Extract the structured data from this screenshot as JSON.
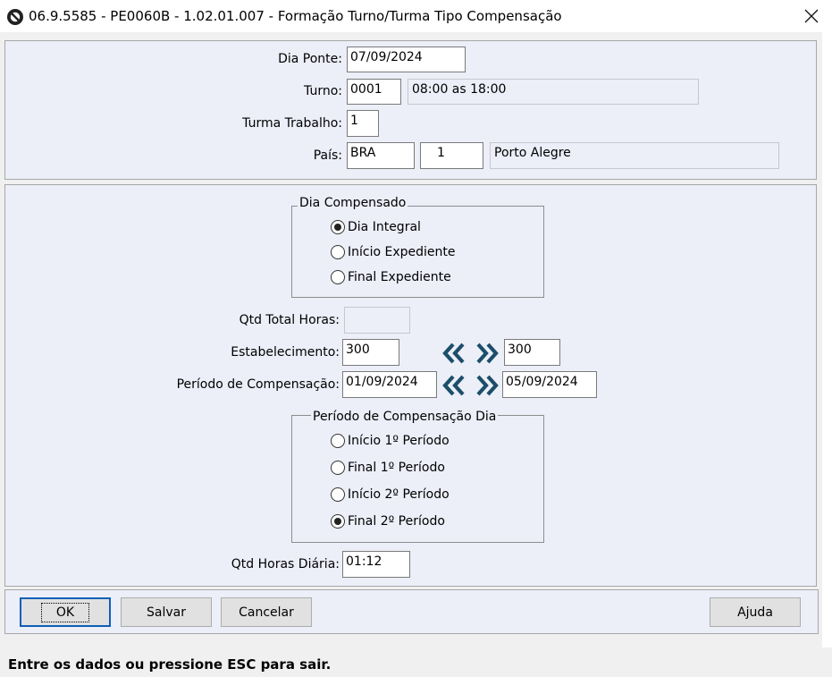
{
  "window": {
    "title": "06.9.5585 - PE0060B - 1.02.01.007 - Formação Turno/Turma Tipo Compensação"
  },
  "form": {
    "dia_ponte": {
      "label": "Dia Ponte:",
      "value": "07/09/2024"
    },
    "turno": {
      "label": "Turno:",
      "value": "0001",
      "description": "08:00 as 18:00"
    },
    "turma_trabalho": {
      "label": "Turma Trabalho:",
      "value": "1"
    },
    "pais": {
      "label": "País:",
      "value": "BRA",
      "code": "1",
      "city": "Porto Alegre"
    },
    "dia_compensado": {
      "legend": "Dia Compensado",
      "options": [
        {
          "label": "Dia Integral",
          "checked": true
        },
        {
          "label": "Início Expediente",
          "checked": false
        },
        {
          "label": "Final Expediente",
          "checked": false
        }
      ]
    },
    "qtd_total_horas": {
      "label": "Qtd Total Horas:",
      "value": ""
    },
    "estabelecimento": {
      "label": "Estabelecimento:",
      "from": "300",
      "to": "300"
    },
    "periodo_compensacao": {
      "label": "Período de Compensação:",
      "from": "01/09/2024",
      "to": "05/09/2024"
    },
    "periodo_compensacao_dia": {
      "legend": "Período de Compensação Dia",
      "options": [
        {
          "label": "Início 1º Período",
          "checked": false
        },
        {
          "label": "Final 1º Período",
          "checked": false
        },
        {
          "label": "Início 2º Período",
          "checked": false
        },
        {
          "label": "Final 2º Período",
          "checked": true
        }
      ]
    },
    "qtd_horas_diaria": {
      "label": "Qtd Horas Diária:",
      "value": "01:12"
    }
  },
  "buttons": {
    "ok": "OK",
    "salvar": "Salvar",
    "cancelar": "Cancelar",
    "ajuda": "Ajuda"
  },
  "status_bar": {
    "text": "Entre os dados ou pressione ESC para sair."
  },
  "icons": {
    "app": "app-logo-icon",
    "close": "close-icon",
    "first": "double-chevron-left-icon",
    "last": "double-chevron-right-icon"
  },
  "colors": {
    "panel": "#eceef8",
    "arrow": "#1c4e69",
    "default_button_border": "#0f5fb8"
  }
}
